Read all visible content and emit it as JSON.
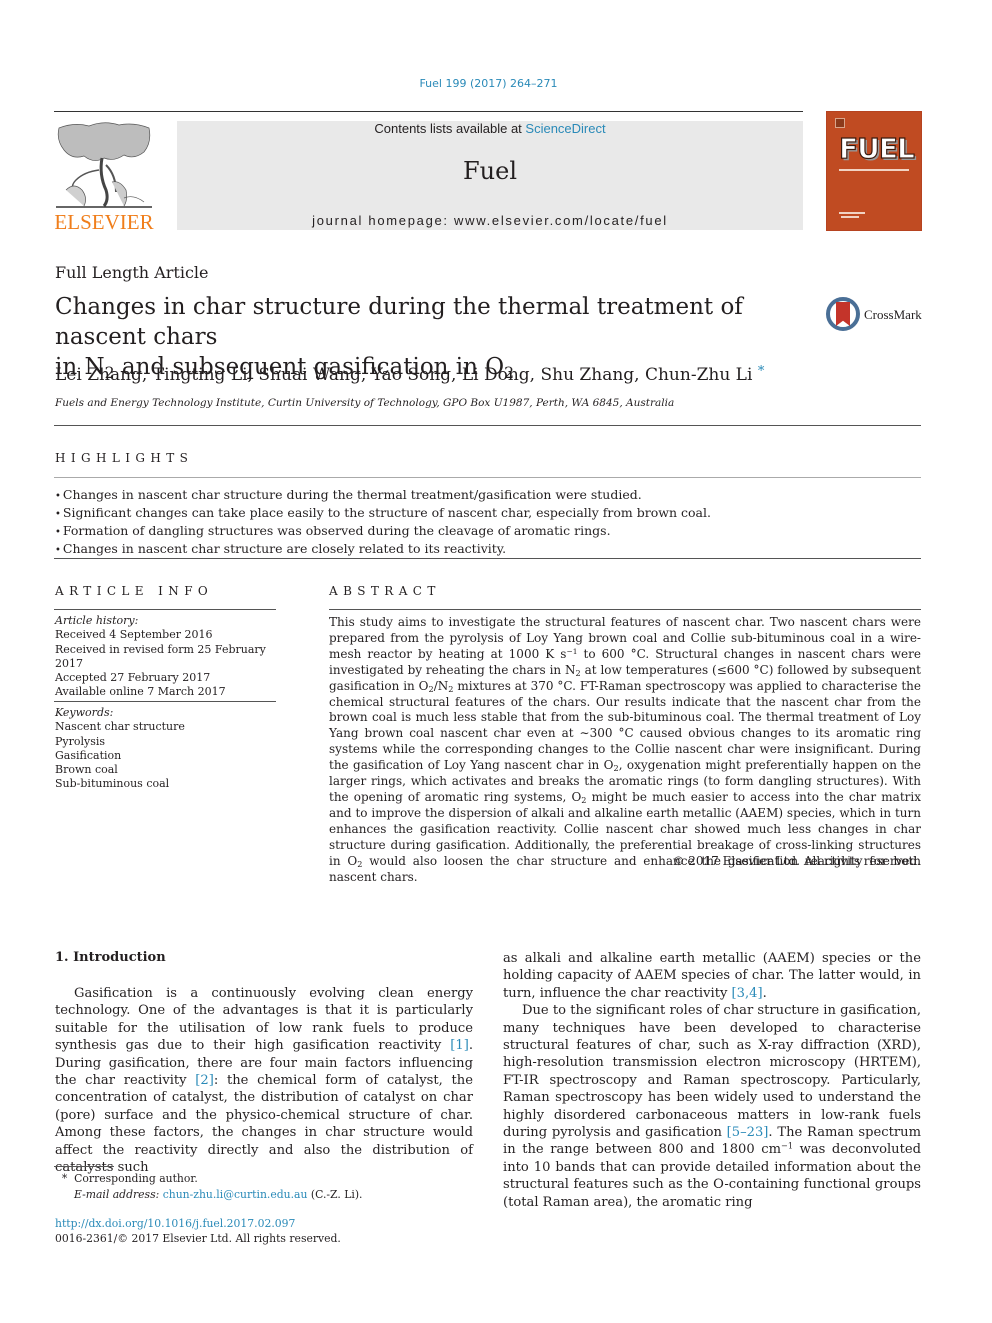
{
  "journal_ref": "Fuel 199 (2017) 264–271",
  "masthead": {
    "contents_prefix": "Contents lists available at ",
    "contents_link": "ScienceDirect",
    "journal_title": "Fuel",
    "homepage": "journal homepage: www.elsevier.com/locate/fuel",
    "publisher_wordmark": "ELSEVIER",
    "cover_title": "FUEL"
  },
  "colors": {
    "link": "#2a8ab8",
    "elsevier_orange": "#f07e1b",
    "cover": "#c04b22",
    "masthead_bg": "#e9e9e9"
  },
  "article": {
    "type": "Full Length Article",
    "title_line1": "Changes in char structure during the thermal treatment of nascent chars",
    "title_line2_a": "in N",
    "title_line2_sub1": "2",
    "title_line2_b": " and subsequent gasification in O",
    "title_line2_sub2": "2",
    "crossmark_label": "CrossMark",
    "authors": "Lei Zhang, Tingting Li, Shuai Wang, Yao Song, Li Dong, Shu Zhang, Chun-Zhu Li",
    "corresponding_mark": "*",
    "affiliation": "Fuels and Energy Technology Institute, Curtin University of Technology, GPO Box U1987, Perth, WA 6845, Australia"
  },
  "highlights": {
    "heading": "HIGHLIGHTS",
    "items": [
      "Changes in nascent char structure during the thermal treatment/gasification were studied.",
      "Significant changes can take place easily to the structure of nascent char, especially from brown coal.",
      "Formation of dangling structures was observed during the cleavage of aromatic rings.",
      "Changes in nascent char structure are closely related to its reactivity."
    ]
  },
  "article_info": {
    "heading": "ARTICLE INFO",
    "history_label": "Article history:",
    "history": [
      "Received 4 September 2016",
      "Received in revised form 25 February 2017",
      "Accepted 27 February 2017",
      "Available online 7 March 2017"
    ],
    "keywords_label": "Keywords:",
    "keywords": [
      "Nascent char structure",
      "Pyrolysis",
      "Gasification",
      "Brown coal",
      "Sub-bituminous coal"
    ]
  },
  "abstract": {
    "heading": "ABSTRACT",
    "p1": "This study aims to investigate the structural features of nascent char. Two nascent chars were prepared from the pyrolysis of Loy Yang brown coal and Collie sub-bituminous coal in a wire-mesh reactor by heating at 1000 K s",
    "p1_sup": "−1",
    "p2": " to 600 °C. Structural changes in nascent chars were investigated by reheating the chars in N",
    "p3": " at low temperatures (≤600 °C) followed by subsequent gasification in O",
    "p4": "/N",
    "p5": " mixtures at 370 °C. FT-Raman spectroscopy was applied to characterise the chemical structural features of the chars. Our results indicate that the nascent char from the brown coal is much less stable that from the sub-bituminous coal. The thermal treatment of Loy Yang brown coal nascent char even at ∼300 °C caused obvious changes to its aromatic ring systems while the corresponding changes to the Collie nascent char were insignificant. During the gasification of Loy Yang nascent char in O",
    "p6": ", oxygenation might preferentially happen on the larger rings, which activates and breaks the aromatic rings (to form dangling structures). With the opening of aromatic ring systems, O",
    "p7": " might be much easier to access into the char matrix and to improve the dispersion of alkali and alkaline earth metallic (AAEM) species, which in turn enhances the gasification reactivity. Collie nascent char showed much less changes in char structure during gasification. Additionally, the preferential breakage of cross-linking structures in O",
    "p8": " would also loosen the char structure and enhance the gasification reactivity for both nascent chars.",
    "sub2": "2",
    "copyright": "© 2017 Elsevier Ltd. All rights reserved."
  },
  "introduction": {
    "heading": "1. Introduction",
    "c1_a": "Gasification is a continuously evolving clean energy technology. One of the advantages is that it is particularly suitable for the utilisation of low rank fuels to produce synthesis gas due to their high gasification reactivity ",
    "c1_ref1": "[1]",
    "c1_b": ". During gasification, there are four main factors influencing the char reactivity ",
    "c1_ref2": "[2]",
    "c1_c": ": the chemical form of catalyst, the concentration of catalyst, the distribution of catalyst on char (pore) surface and the physico-chemical structure of char. Among these factors, the changes in char structure would affect the reactivity directly and also the distribution of catalysts such",
    "c2_a": "as alkali and alkaline earth metallic (AAEM) species or the holding capacity of AAEM species of char. The latter would, in turn, influence the char reactivity ",
    "c2_ref1": "[3,4]",
    "c2_b": ".",
    "c2_p2_a": "Due to the significant roles of char structure in gasification, many techniques have been developed to characterise structural features of char, such as X-ray diffraction (XRD), high-resolution transmission electron microscopy (HRTEM), FT-IR spectroscopy and Raman spectroscopy. Particularly, Raman spectroscopy has been widely used to understand the highly disordered carbonaceous matters in low-rank fuels during pyrolysis and gasification ",
    "c2_ref2": "[5–23]",
    "c2_p2_b": ". The Raman spectrum in the range between 800 and 1800 cm",
    "c2_sup": "−1",
    "c2_p2_c": " was deconvoluted into 10 bands that can provide detailed information about the structural features such as the O-containing functional groups (total Raman area), the aromatic ring"
  },
  "footnotes": {
    "mark": "*",
    "corresponding": "Corresponding author.",
    "email_label": "E-mail address:",
    "email": "chun-zhu.li@curtin.edu.au",
    "email_suffix": " (C.-Z. Li).",
    "doi": "http://dx.doi.org/10.1016/j.fuel.2017.02.097",
    "issn_line": "0016-2361/© 2017 Elsevier Ltd. All rights reserved."
  }
}
